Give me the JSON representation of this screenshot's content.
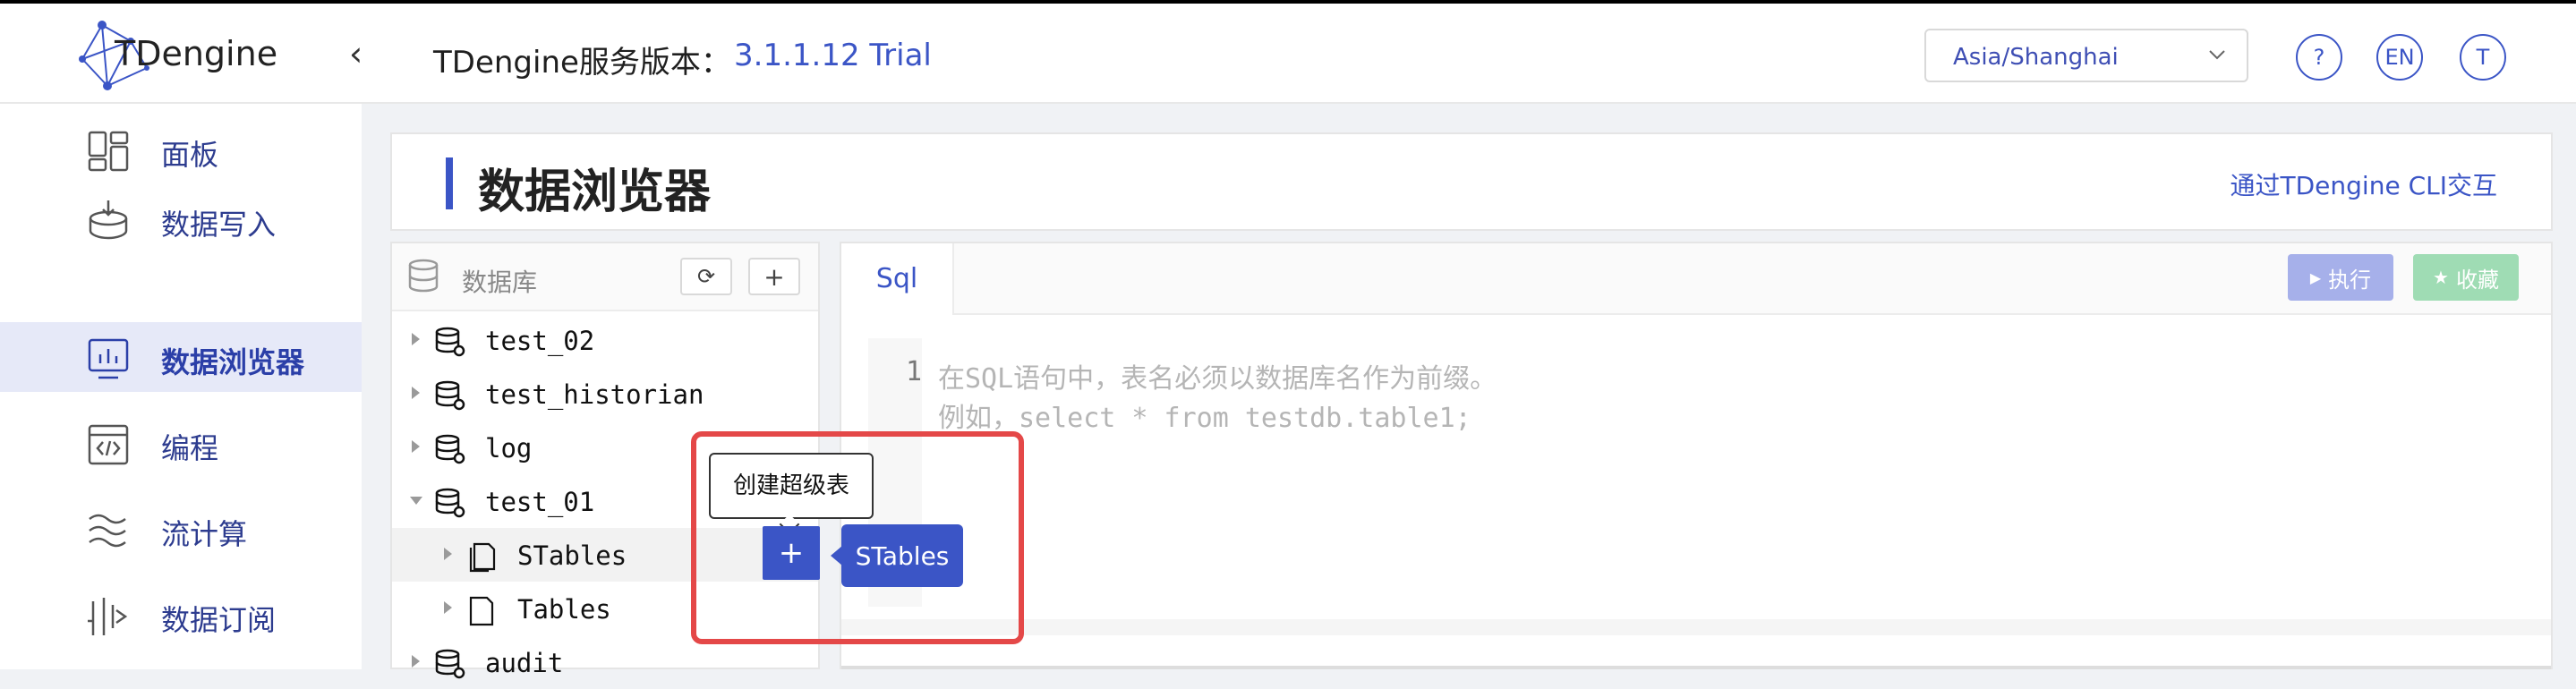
{
  "header": {
    "logo_text": "TDengine",
    "version_label": "TDengine服务版本：",
    "version_value": "3.1.1.12 Trial",
    "timezone": "Asia/Shanghai",
    "help_label": "?",
    "lang_label": "EN",
    "user_label": "T"
  },
  "sidebar": {
    "items": [
      {
        "label": "面板",
        "icon": "dashboard-icon"
      },
      {
        "label": "数据写入",
        "icon": "data-write-icon"
      },
      {
        "label": "数据浏览器",
        "icon": "data-browser-icon",
        "active": true
      },
      {
        "label": "编程",
        "icon": "code-icon"
      },
      {
        "label": "流计算",
        "icon": "stream-icon"
      },
      {
        "label": "数据订阅",
        "icon": "subscribe-icon"
      }
    ]
  },
  "page": {
    "title": "数据浏览器",
    "cli_link": "通过TDengine CLI交互"
  },
  "db_panel": {
    "header_label": "数据库",
    "refresh_icon": "⟳",
    "add_icon": "+",
    "tree": [
      {
        "label": "test_02",
        "type": "database",
        "expanded": false
      },
      {
        "label": "test_historian",
        "type": "database",
        "expanded": false
      },
      {
        "label": "log",
        "type": "database",
        "expanded": false
      },
      {
        "label": "test_01",
        "type": "database",
        "expanded": true
      },
      {
        "label": "STables",
        "type": "folder",
        "expanded": false
      },
      {
        "label": "Tables",
        "type": "folder",
        "expanded": false
      },
      {
        "label": "audit",
        "type": "database",
        "expanded": false
      }
    ]
  },
  "popup": {
    "tooltip": "创建超级表",
    "plus": "+",
    "tag": "STables"
  },
  "sql_panel": {
    "tab": "Sql",
    "run_label": "执行",
    "fav_label": "收藏",
    "line_number": "1",
    "placeholder_line1": "在SQL语句中，表名必须以数据库名作为前缀。",
    "placeholder_line2": "例如，select * from testdb.table1;"
  },
  "colors": {
    "accent": "#3b55c6",
    "highlight": "#e44848",
    "active_nav_bg": "#e6e9f8"
  }
}
